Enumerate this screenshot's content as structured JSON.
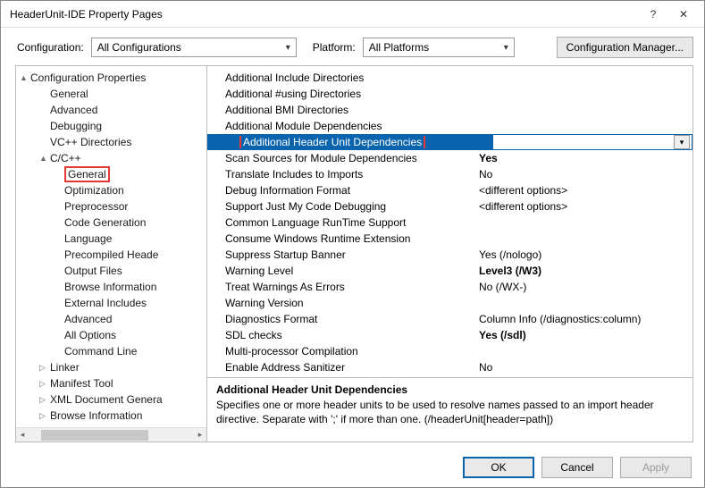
{
  "title": "HeaderUnit-IDE Property Pages",
  "toolbar": {
    "config_label": "Configuration:",
    "config_value": "All Configurations",
    "platform_label": "Platform:",
    "platform_value": "All Platforms",
    "cfgmgr_label": "Configuration Manager..."
  },
  "tree": {
    "items": [
      {
        "d": 0,
        "arrow": "▲",
        "label": "Configuration Properties"
      },
      {
        "d": 1,
        "arrow": "",
        "label": "General"
      },
      {
        "d": 1,
        "arrow": "",
        "label": "Advanced"
      },
      {
        "d": 1,
        "arrow": "",
        "label": "Debugging"
      },
      {
        "d": 1,
        "arrow": "",
        "label": "VC++ Directories"
      },
      {
        "d": 1,
        "arrow": "▲",
        "label": "C/C++"
      },
      {
        "d": 2,
        "arrow": "",
        "label": "General",
        "hl": true
      },
      {
        "d": 2,
        "arrow": "",
        "label": "Optimization"
      },
      {
        "d": 2,
        "arrow": "",
        "label": "Preprocessor"
      },
      {
        "d": 2,
        "arrow": "",
        "label": "Code Generation"
      },
      {
        "d": 2,
        "arrow": "",
        "label": "Language"
      },
      {
        "d": 2,
        "arrow": "",
        "label": "Precompiled Heade"
      },
      {
        "d": 2,
        "arrow": "",
        "label": "Output Files"
      },
      {
        "d": 2,
        "arrow": "",
        "label": "Browse Information"
      },
      {
        "d": 2,
        "arrow": "",
        "label": "External Includes"
      },
      {
        "d": 2,
        "arrow": "",
        "label": "Advanced"
      },
      {
        "d": 2,
        "arrow": "",
        "label": "All Options"
      },
      {
        "d": 2,
        "arrow": "",
        "label": "Command Line"
      },
      {
        "d": 1,
        "arrow": "▷",
        "label": "Linker"
      },
      {
        "d": 1,
        "arrow": "▷",
        "label": "Manifest Tool"
      },
      {
        "d": 1,
        "arrow": "▷",
        "label": "XML Document Genera"
      },
      {
        "d": 1,
        "arrow": "▷",
        "label": "Browse Information"
      }
    ]
  },
  "props": {
    "rows": [
      {
        "k": "Additional Include Directories",
        "v": ""
      },
      {
        "k": "Additional #using Directories",
        "v": ""
      },
      {
        "k": "Additional BMI Directories",
        "v": ""
      },
      {
        "k": "Additional Module Dependencies",
        "v": ""
      },
      {
        "k": "Additional Header Unit Dependencies",
        "v": "",
        "sel": true
      },
      {
        "k": "Scan Sources for Module Dependencies",
        "v": "Yes",
        "bold": true
      },
      {
        "k": "Translate Includes to Imports",
        "v": "No"
      },
      {
        "k": "Debug Information Format",
        "v": "<different options>"
      },
      {
        "k": "Support Just My Code Debugging",
        "v": "<different options>"
      },
      {
        "k": "Common Language RunTime Support",
        "v": ""
      },
      {
        "k": "Consume Windows Runtime Extension",
        "v": ""
      },
      {
        "k": "Suppress Startup Banner",
        "v": "Yes (/nologo)"
      },
      {
        "k": "Warning Level",
        "v": "Level3 (/W3)",
        "bold": true
      },
      {
        "k": "Treat Warnings As Errors",
        "v": "No (/WX-)"
      },
      {
        "k": "Warning Version",
        "v": ""
      },
      {
        "k": "Diagnostics Format",
        "v": "Column Info (/diagnostics:column)"
      },
      {
        "k": "SDL checks",
        "v": "Yes (/sdl)",
        "bold": true
      },
      {
        "k": "Multi-processor Compilation",
        "v": ""
      },
      {
        "k": "Enable Address Sanitizer",
        "v": "No"
      }
    ]
  },
  "desc": {
    "title": "Additional Header Unit Dependencies",
    "text": "Specifies one or more header units to be used to resolve names passed to an import header directive. Separate with ';' if more than one.  (/headerUnit[header=path])"
  },
  "footer": {
    "ok": "OK",
    "cancel": "Cancel",
    "apply": "Apply"
  }
}
